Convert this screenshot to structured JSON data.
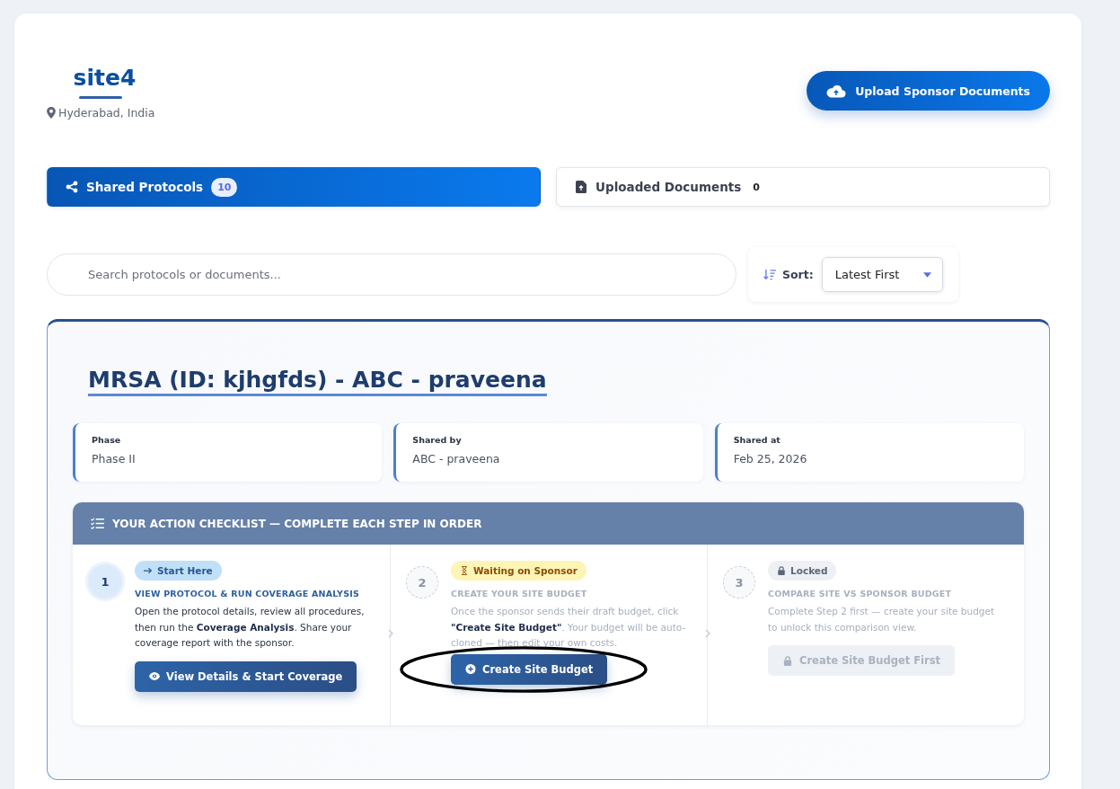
{
  "site": {
    "name": "site4",
    "location": "Hyderabad, India"
  },
  "upload_button": {
    "label": "Upload Sponsor Documents"
  },
  "tabs": [
    {
      "label": "Shared Protocols",
      "count": "10",
      "selected": true
    },
    {
      "label": "Uploaded Documents",
      "count": "0",
      "selected": false
    }
  ],
  "search": {
    "placeholder": "Search protocols or documents..."
  },
  "sort": {
    "label": "Sort:",
    "value": "Latest First"
  },
  "protocol": {
    "title": "MRSA (ID: kjhgfds) - ABC - praveena",
    "info": [
      {
        "label": "Phase",
        "value": "Phase II"
      },
      {
        "label": "Shared by",
        "value": "ABC - praveena"
      },
      {
        "label": "Shared at",
        "value": "Feb 25, 2026"
      }
    ],
    "checklist": {
      "title": "YOUR ACTION CHECKLIST — COMPLETE EACH STEP IN ORDER",
      "steps": [
        {
          "kind": "active",
          "number": "1",
          "badge": "Start Here",
          "heading": "VIEW PROTOCOL & RUN COVERAGE ANALYSIS",
          "text": "Open the protocol details, review all procedures, then run the **Coverage Analysis**. Share your coverage report with the sponsor.",
          "button": "View Details & Start Coverage",
          "circled": false
        },
        {
          "kind": "waiting",
          "number": "2",
          "badge": "Waiting on Sponsor",
          "heading": "CREATE YOUR SITE BUDGET",
          "text": "Once the sponsor sends their draft budget, click **\"Create Site Budget\"**. Your budget will be auto-cloned — then edit your own costs.",
          "button": "Create Site Budget",
          "circled": true
        },
        {
          "kind": "locked",
          "number": "3",
          "badge": "Locked",
          "heading": "COMPARE SITE VS SPONSOR BUDGET",
          "text": "Complete Step 2 first — create your site budget to unlock this comparison view.",
          "button": "Create Site Budget First",
          "circled": false
        }
      ]
    }
  }
}
